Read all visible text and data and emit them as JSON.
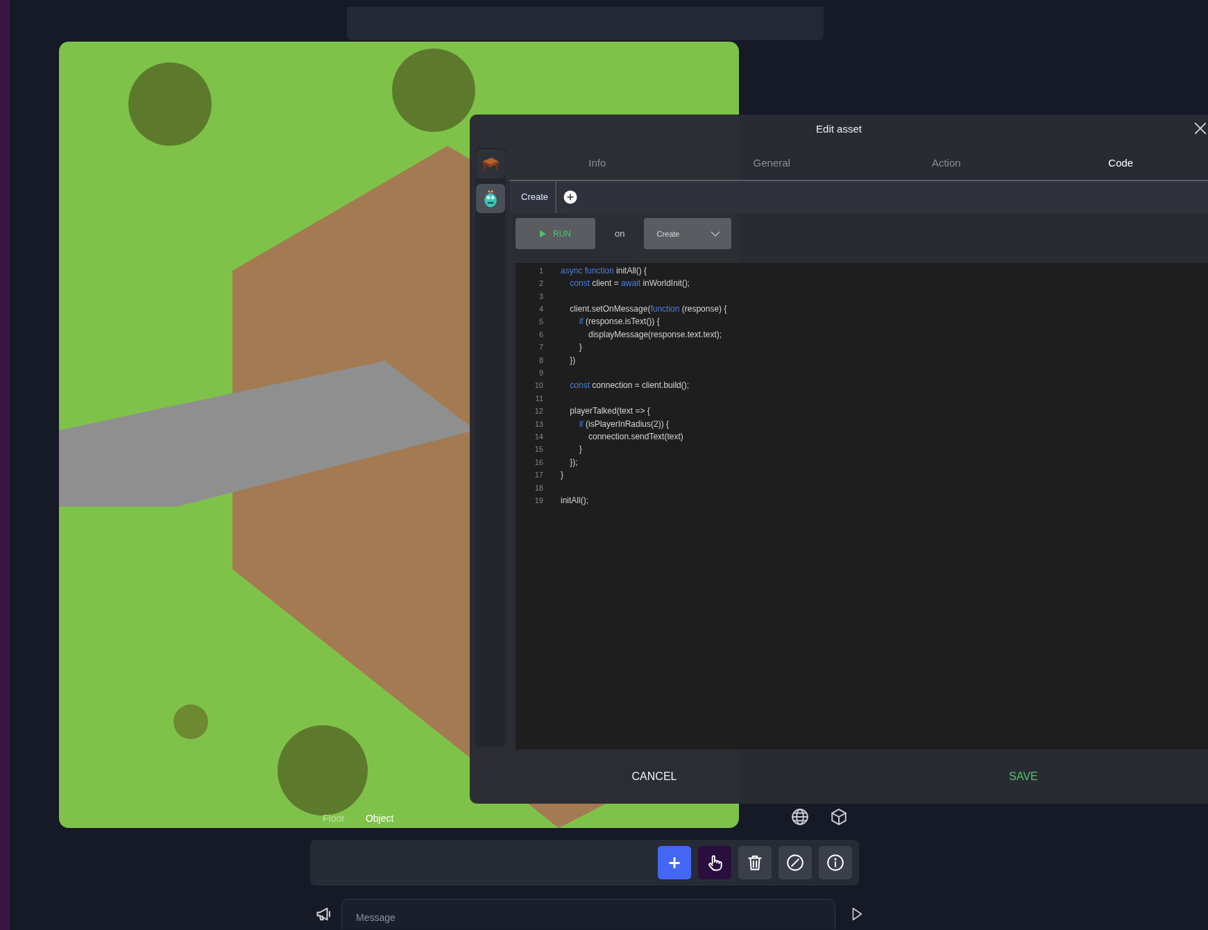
{
  "map": {
    "layers": [
      {
        "label": "Floor",
        "selected": false
      },
      {
        "label": "Object",
        "selected": true
      }
    ]
  },
  "dialog": {
    "title": "Edit asset",
    "assets": [
      {
        "kind": "table",
        "selected": false
      },
      {
        "kind": "monster",
        "selected": true
      }
    ],
    "tabs": [
      {
        "label": "Info",
        "selected": false
      },
      {
        "label": "General",
        "selected": false
      },
      {
        "label": "Action",
        "selected": false
      },
      {
        "label": "Code",
        "selected": true
      }
    ],
    "events": [
      {
        "label": "Create",
        "selected": true
      }
    ],
    "run_button": "RUN",
    "run_on": "on",
    "event_select": {
      "value": "Create"
    },
    "code": {
      "lines": [
        {
          "number": "1",
          "tokens": [
            {
              "text": "async function",
              "kind": "keyword"
            },
            {
              "text": " initAll() {",
              "kind": "plain"
            }
          ]
        },
        {
          "number": "2",
          "tokens": [
            {
              "text": "    const",
              "kind": "keyword"
            },
            {
              "text": " client = ",
              "kind": "plain"
            },
            {
              "text": "await",
              "kind": "keyword"
            },
            {
              "text": " inWorldInit();",
              "kind": "plain"
            }
          ]
        },
        {
          "number": "3"
        },
        {
          "number": "4",
          "tokens": [
            {
              "text": "    client.setOnMessage(",
              "kind": "plain"
            },
            {
              "text": "function",
              "kind": "keyword"
            },
            {
              "text": " (response) {",
              "kind": "plain"
            }
          ]
        },
        {
          "number": "5",
          "tokens": [
            {
              "text": "        if",
              "kind": "keyword"
            },
            {
              "text": " (response.isText()) {",
              "kind": "plain"
            }
          ]
        },
        {
          "number": "6",
          "tokens": [
            {
              "text": "            displayMessage(response.text.text);",
              "kind": "plain"
            }
          ]
        },
        {
          "number": "7",
          "tokens": [
            {
              "text": "        }",
              "kind": "plain"
            }
          ]
        },
        {
          "number": "8",
          "tokens": [
            {
              "text": "    })",
              "kind": "plain"
            }
          ]
        },
        {
          "number": "9"
        },
        {
          "number": "10",
          "tokens": [
            {
              "text": "    const",
              "kind": "keyword"
            },
            {
              "text": " connection = client.build();",
              "kind": "plain"
            }
          ]
        },
        {
          "number": "11"
        },
        {
          "number": "12",
          "tokens": [
            {
              "text": "    playerTalked(text => {",
              "kind": "plain"
            }
          ]
        },
        {
          "number": "13",
          "tokens": [
            {
              "text": "        if",
              "kind": "keyword"
            },
            {
              "text": " (isPlayerInRadius(2)) {",
              "kind": "plain"
            }
          ]
        },
        {
          "number": "14",
          "tokens": [
            {
              "text": "            connection.sendText(text)",
              "kind": "plain"
            }
          ]
        },
        {
          "number": "15",
          "tokens": [
            {
              "text": "        }",
              "kind": "plain"
            }
          ]
        },
        {
          "number": "16",
          "tokens": [
            {
              "text": "    });",
              "kind": "plain"
            }
          ]
        },
        {
          "number": "17",
          "tokens": [
            {
              "text": "}",
              "kind": "plain"
            }
          ]
        },
        {
          "number": "18"
        },
        {
          "number": "19",
          "tokens": [
            {
              "text": "initAll();",
              "kind": "plain"
            }
          ]
        }
      ]
    },
    "footer": [
      {
        "label": "CANCEL",
        "kind": "secondary"
      },
      {
        "label": "SAVE",
        "kind": "primary"
      }
    ]
  },
  "toolbar": [
    {
      "kind": "add",
      "label": "+",
      "color": "#4466f5"
    },
    {
      "kind": "hand",
      "color": "#2a0f3e"
    },
    {
      "kind": "delete",
      "color": "#3b3f4a"
    },
    {
      "kind": "disable",
      "color": "#3b3f4a"
    },
    {
      "kind": "info",
      "color": "#3b3f4a"
    }
  ],
  "chat": {
    "placeholder": "Message"
  }
}
